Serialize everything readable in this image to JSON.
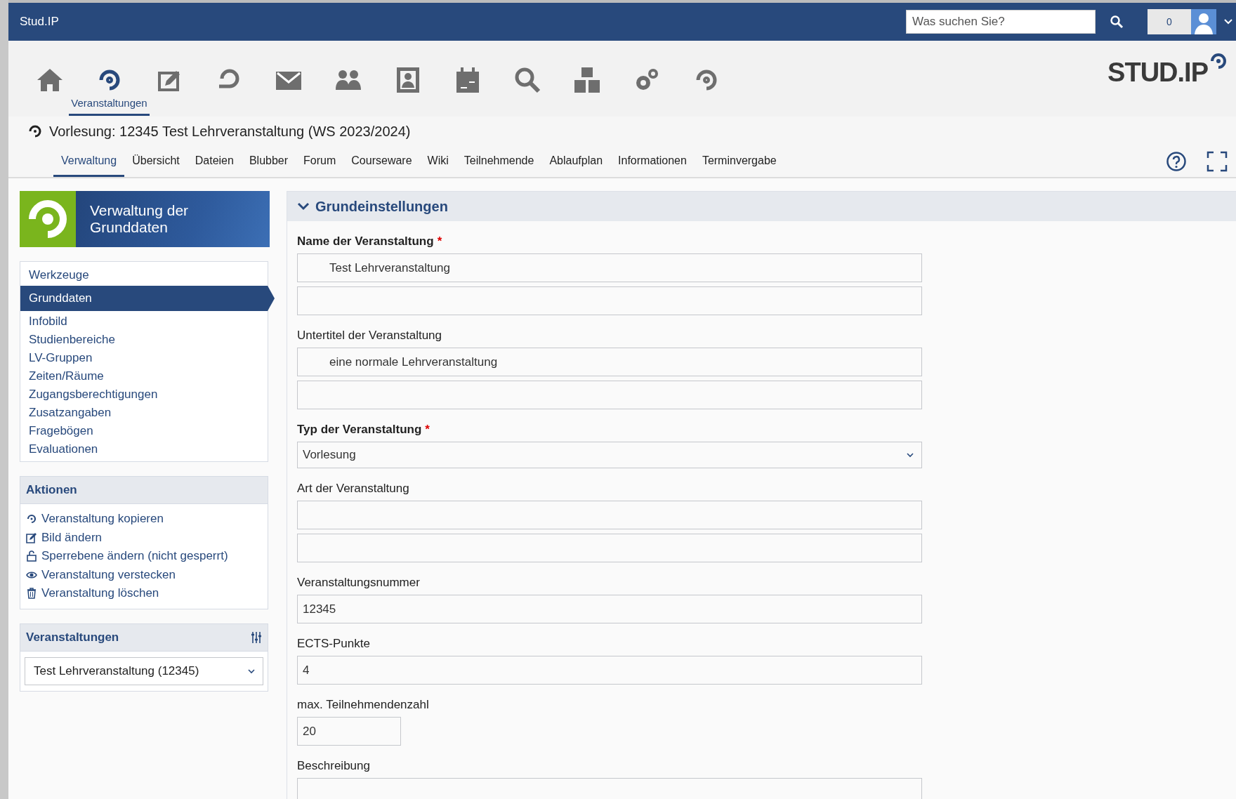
{
  "topbar": {
    "site": "Stud.IP",
    "search": {
      "placeholder": "Was suchen Sie?"
    },
    "notifications": "0"
  },
  "nav": [
    {
      "selected": false
    },
    {
      "selected": true,
      "label": "Veranstaltungen"
    },
    {
      "selected": false
    },
    {
      "selected": false
    },
    {
      "selected": false
    },
    {
      "selected": false
    },
    {
      "selected": false
    },
    {
      "selected": false
    },
    {
      "selected": false
    },
    {
      "selected": false
    },
    {
      "selected": false
    },
    {
      "selected": false
    }
  ],
  "logo": "STUD.IP",
  "course_title": "Vorlesung: 12345 Test Lehrveranstaltung (WS 2023/2024)",
  "tabs": [
    {
      "label": "Verwaltung",
      "selected": true
    },
    {
      "label": "Übersicht",
      "selected": false
    },
    {
      "label": "Dateien",
      "selected": false
    },
    {
      "label": "Blubber",
      "selected": false
    },
    {
      "label": "Forum",
      "selected": false
    },
    {
      "label": "Courseware",
      "selected": false
    },
    {
      "label": "Wiki",
      "selected": false
    },
    {
      "label": "Teilnehmende",
      "selected": false
    },
    {
      "label": "Ablaufplan",
      "selected": false
    },
    {
      "label": "Informationen",
      "selected": false
    },
    {
      "label": "Terminvergabe",
      "selected": false
    }
  ],
  "sidebar": {
    "title": "Verwaltung der Grunddaten",
    "items": [
      {
        "label": "Werkzeuge",
        "selected": false
      },
      {
        "label": "Grunddaten",
        "selected": true
      },
      {
        "label": "Infobild",
        "selected": false
      },
      {
        "label": "Studienbereiche",
        "selected": false
      },
      {
        "label": "LV-Gruppen",
        "selected": false
      },
      {
        "label": "Zeiten/Räume",
        "selected": false
      },
      {
        "label": "Zugangsberechtigungen",
        "selected": false
      },
      {
        "label": "Zusatzangaben",
        "selected": false
      },
      {
        "label": "Fragebögen",
        "selected": false
      },
      {
        "label": "Evaluationen",
        "selected": false
      }
    ],
    "actions": {
      "title": "Aktionen",
      "items": [
        {
          "label": "Veranstaltung kopieren"
        },
        {
          "label": "Bild ändern"
        },
        {
          "label": "Sperrebene ändern (nicht gesperrt)"
        },
        {
          "label": "Veranstaltung verstecken"
        },
        {
          "label": "Veranstaltung löschen"
        }
      ]
    },
    "courses": {
      "title": "Veranstaltungen",
      "value": "Test Lehrveranstaltung (12345)"
    }
  },
  "section": {
    "title": "Grundeinstellungen",
    "expanded": true,
    "fields": [
      {
        "label": "Name der Veranstaltung",
        "required": true,
        "marker": "*",
        "kind": "i18n",
        "value": "Test Lehrveranstaltung"
      },
      {
        "label": "Untertitel der Veranstaltung",
        "required": false,
        "kind": "i18n",
        "value": "eine normale Lehrveranstaltung"
      },
      {
        "label": "Typ der Veranstaltung",
        "required": true,
        "marker": "*",
        "kind": "select",
        "value": "Vorlesung"
      },
      {
        "label": "Art der Veranstaltung",
        "required": false,
        "kind": "i18n"
      },
      {
        "label": "Veranstaltungsnummer",
        "required": false,
        "kind": "text",
        "value": "12345"
      },
      {
        "label": "ECTS-Punkte",
        "required": false,
        "kind": "text",
        "value": "4"
      },
      {
        "label": "max. Teilnehmendenzahl",
        "required": false,
        "kind": "short",
        "value": "20"
      },
      {
        "label": "Beschreibung",
        "required": false,
        "kind": "textarea"
      }
    ]
  }
}
